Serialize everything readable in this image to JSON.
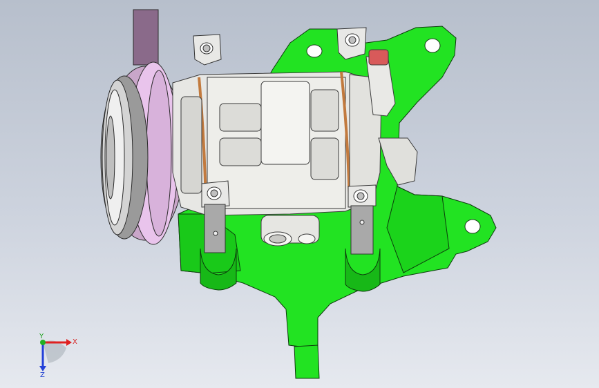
{
  "viewport": {
    "background_top": "#b7bfcc",
    "background_bottom": "#e6e9ef"
  },
  "model": {
    "bracket_color": "#1ee61e",
    "body_color": "#e6e6e3",
    "pulley_color": "#d9a8d9",
    "fitting_color": "#d85a5a",
    "gasket_color": "#c07840"
  },
  "triad": {
    "x_label": "X",
    "y_label": "Y",
    "z_label": "Z",
    "x_color": "#e01f1f",
    "y_color": "#22b022",
    "z_color": "#2340d8"
  }
}
